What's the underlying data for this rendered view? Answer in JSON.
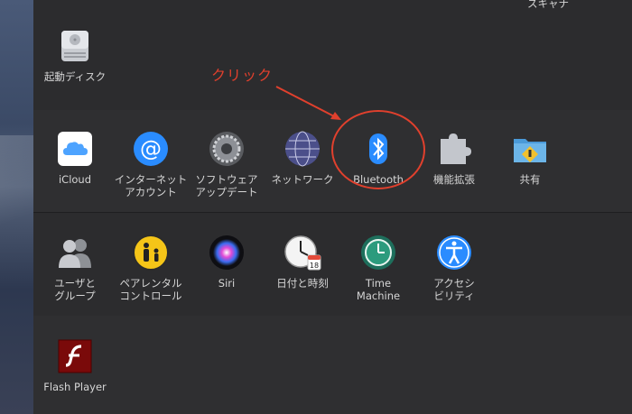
{
  "annotation": {
    "text": "クリック",
    "color": "#e0402d"
  },
  "row0": {
    "partial_label": "スキャナ",
    "items": [
      {
        "label": "起動ディスク",
        "icon": "hard-disk-icon"
      }
    ]
  },
  "row1": {
    "items": [
      {
        "label": "iCloud",
        "icon": "icloud-icon"
      },
      {
        "label": "インターネット\nアカウント",
        "icon": "internet-accounts-icon"
      },
      {
        "label": "ソフトウェア\nアップデート",
        "icon": "software-update-gear-icon"
      },
      {
        "label": "ネットワーク",
        "icon": "network-globe-icon"
      },
      {
        "label": "Bluetooth",
        "icon": "bluetooth-icon"
      },
      {
        "label": "機能拡張",
        "icon": "extensions-puzzle-icon"
      },
      {
        "label": "共有",
        "icon": "sharing-folder-icon"
      }
    ]
  },
  "row2": {
    "items": [
      {
        "label": "ユーザと\nグループ",
        "icon": "users-groups-icon"
      },
      {
        "label": "ペアレンタル\nコントロール",
        "icon": "parental-controls-icon"
      },
      {
        "label": "Siri",
        "icon": "siri-icon"
      },
      {
        "label": "日付と時刻",
        "icon": "date-time-clock-icon"
      },
      {
        "label": "Time\nMachine",
        "icon": "time-machine-icon"
      },
      {
        "label": "アクセシ\nビリティ",
        "icon": "accessibility-icon"
      }
    ]
  },
  "row3": {
    "items": [
      {
        "label": "Flash Player",
        "icon": "flash-player-icon"
      }
    ]
  },
  "colors": {
    "accent_blue": "#2a8cff",
    "annotation_red": "#e0402d"
  }
}
